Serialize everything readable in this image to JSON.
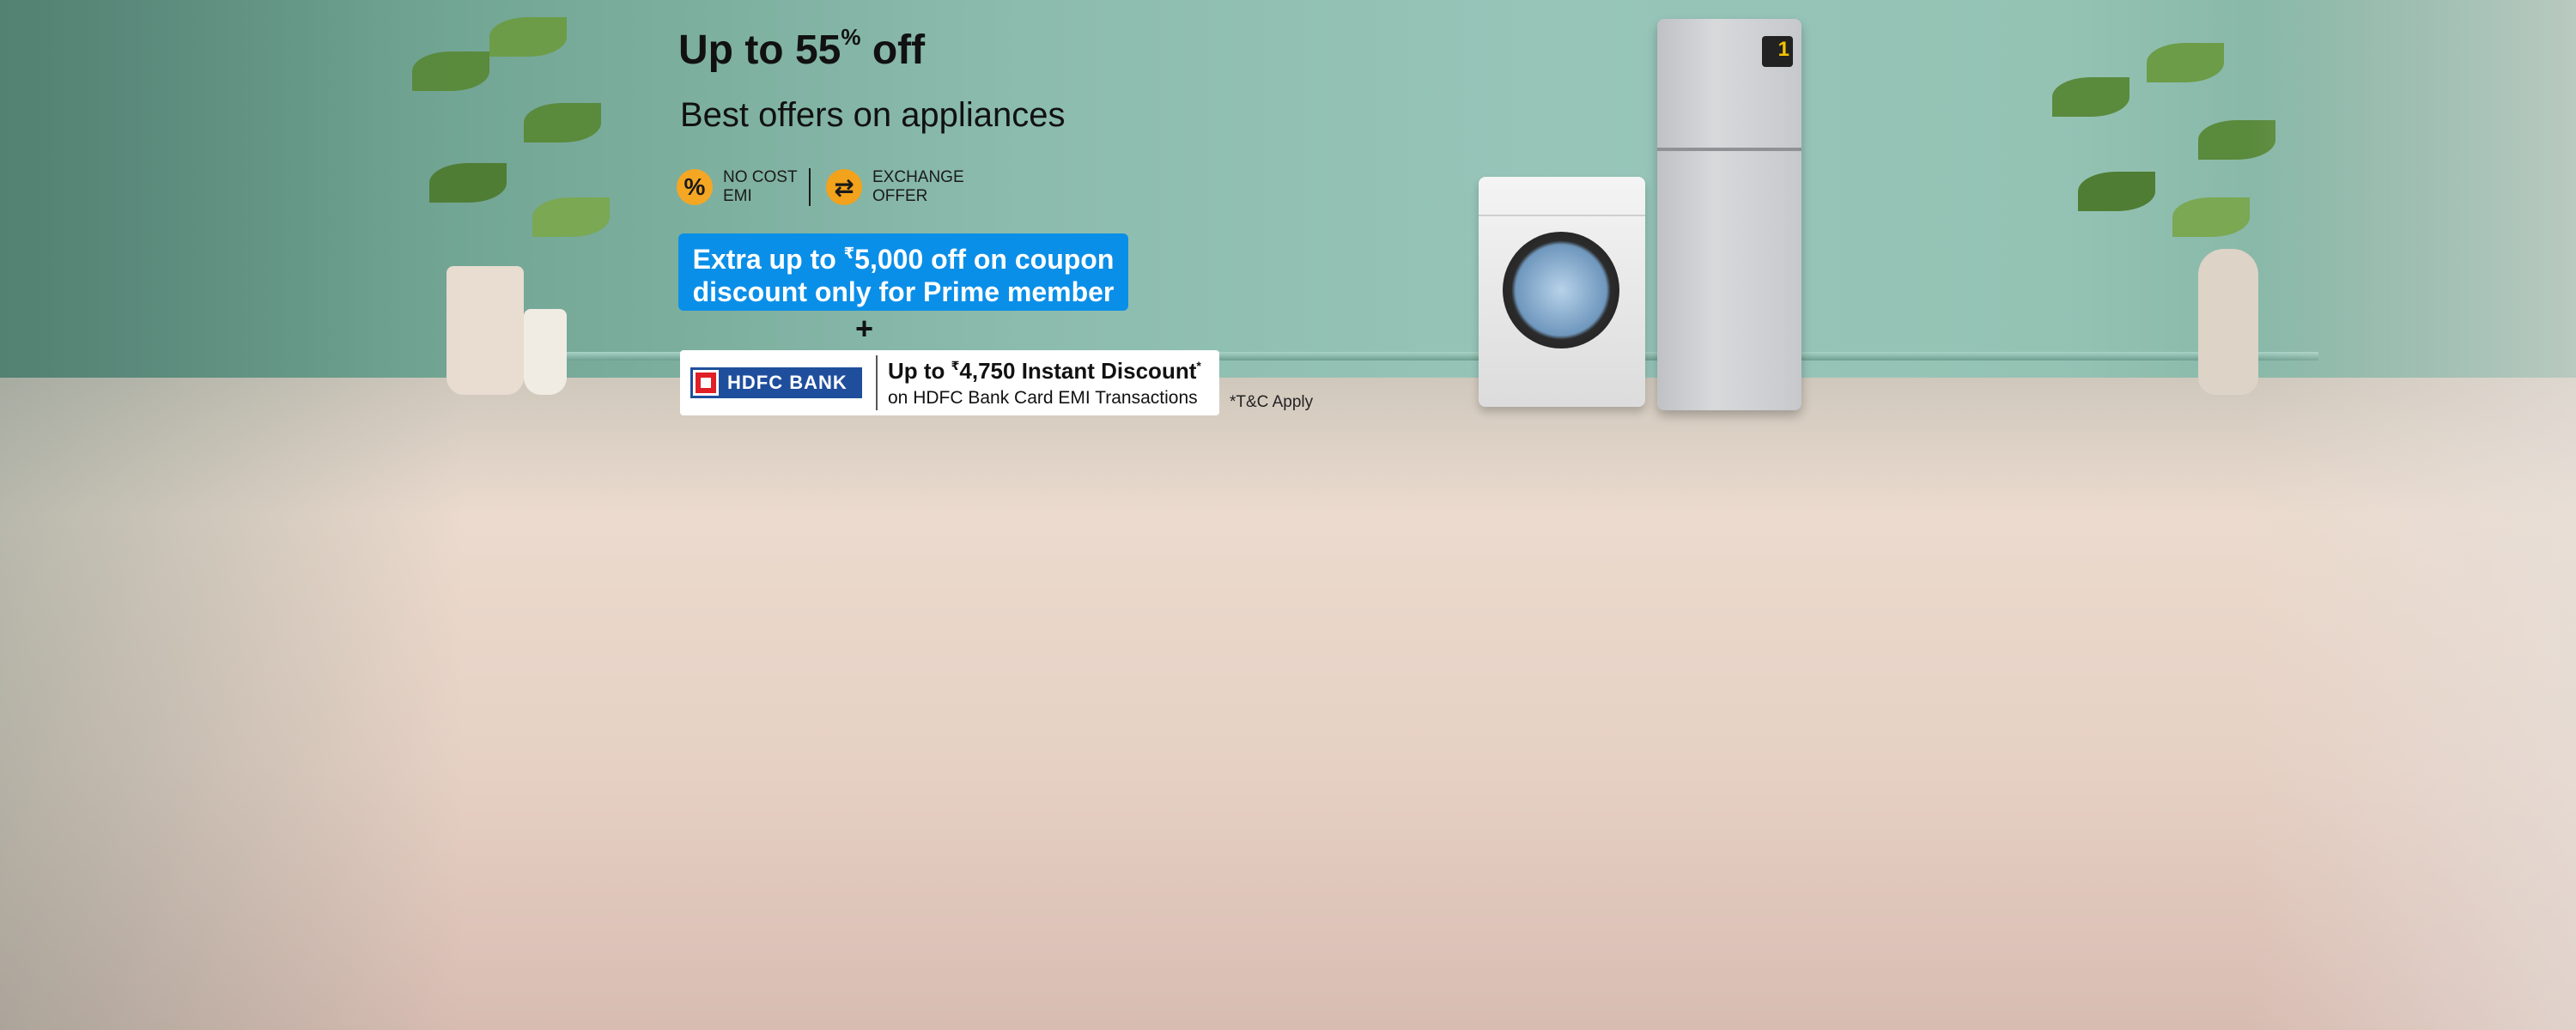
{
  "headline": {
    "prefix": "Up to 55",
    "sup": "%",
    "suffix": " off"
  },
  "subheadline": "Best offers on appliances",
  "features": [
    {
      "icon": "percent-icon",
      "glyph": "%",
      "label": "NO COST EMI"
    },
    {
      "icon": "exchange-icon",
      "glyph": "⇄",
      "label": "EXCHANGE OFFER"
    }
  ],
  "coupon": {
    "line1_prefix": "Extra up to ",
    "line1_currency": "₹",
    "line1_suffix": "5,000 off on coupon",
    "line2": "discount only for Prime member"
  },
  "plus": "+",
  "bank_offer": {
    "bank_name": "HDFC BANK",
    "line1_prefix": "Up to ",
    "line1_currency": "₹",
    "line1_amount": "4,750 Instant Discount",
    "line1_mark": "*",
    "line2": "on HDFC Bank Card EMI Transactions"
  },
  "terms": "*T&C Apply",
  "colors": {
    "coupon_bg": "#0a8fe8",
    "icon_orange": "#f5a623",
    "bank_blue": "#1f4f9c",
    "bank_red": "#e01f26"
  }
}
